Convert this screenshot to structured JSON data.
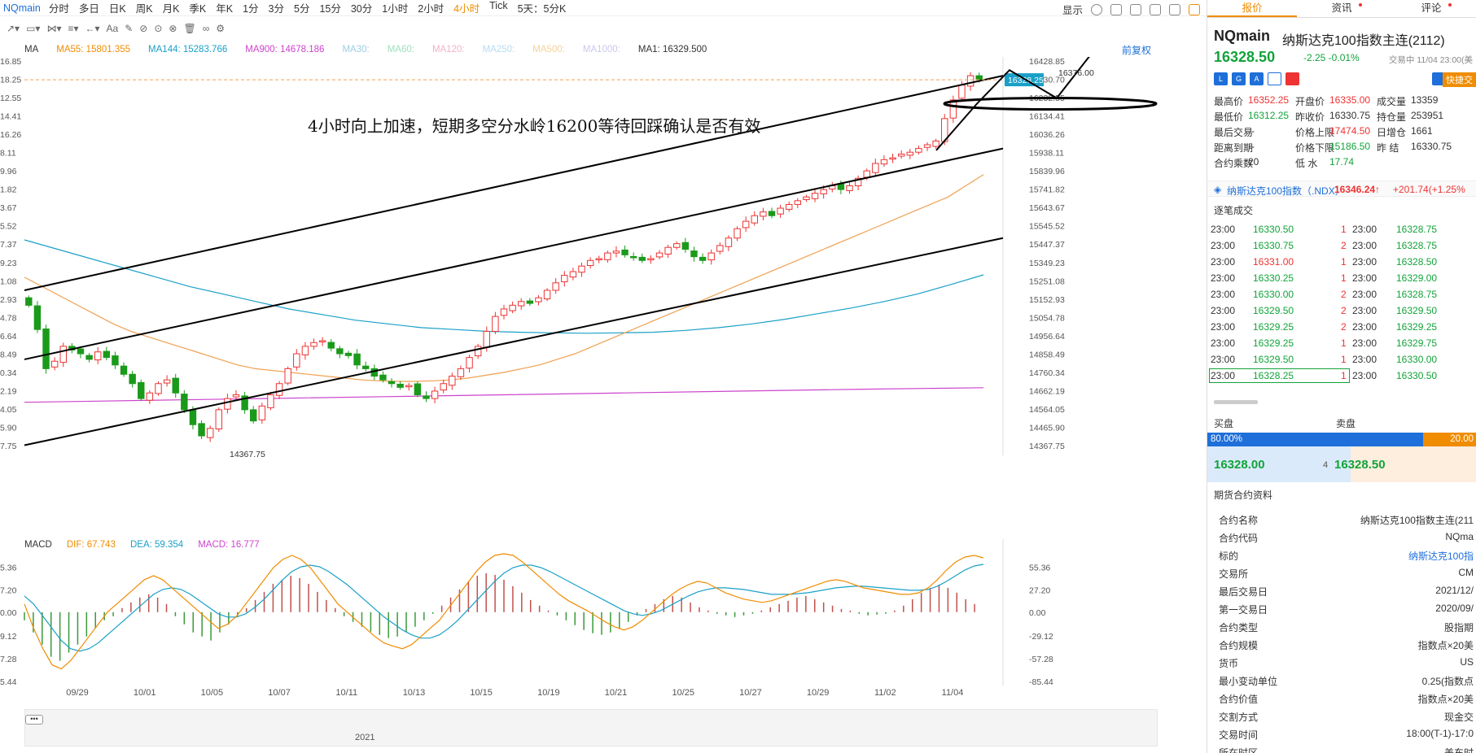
{
  "toolbar": {
    "symbol": "NQmain",
    "periods": [
      "分时",
      "多日",
      "日K",
      "周K",
      "月K",
      "季K",
      "年K",
      "1分",
      "3分",
      "5分",
      "15分",
      "30分",
      "1小时",
      "2小时",
      "4小时",
      "Tick",
      "5天：5分K"
    ],
    "active_period": "4小时",
    "display": "显示"
  },
  "indicators": {
    "ma_label": "MA",
    "items": [
      {
        "label": "MA55: 15801.355",
        "color": "#f08c00"
      },
      {
        "label": "MA144: 15283.766",
        "color": "#1aa0c8"
      },
      {
        "label": "MA900: 14678.186",
        "color": "#cc44cc"
      },
      {
        "label": "MA30:",
        "color": "#9ccde6"
      },
      {
        "label": "MA60:",
        "color": "#9fe0c0"
      },
      {
        "label": "MA120:",
        "color": "#f3b2c6"
      },
      {
        "label": "MA250:",
        "color": "#b7dbf2"
      },
      {
        "label": "MA500:",
        "color": "#f6d29a"
      },
      {
        "label": "MA1000:",
        "color": "#c9c9f0"
      },
      {
        "label": "MA1: 16329.500",
        "color": "#333333"
      }
    ],
    "fuquan": "前复权"
  },
  "chart_data": [
    {
      "type": "candlestick",
      "title": "",
      "y_ticks": [
        16428.85,
        16330.7,
        16232.55,
        16134.41,
        16036.26,
        15938.11,
        15839.96,
        15741.82,
        15643.67,
        15545.52,
        15447.37,
        15349.23,
        15251.08,
        15152.93,
        15054.78,
        14956.64,
        14858.49,
        14760.34,
        14662.19,
        14564.05,
        14465.9,
        14367.75
      ],
      "ylim": [
        14367.75,
        16428.85
      ],
      "x_labels": [
        "09/29",
        "10/01",
        "10/05",
        "10/07",
        "10/11",
        "10/13",
        "10/15",
        "10/19",
        "10/21",
        "10/25",
        "10/27",
        "10/29",
        "11/02",
        "11/04"
      ],
      "annotation": "4小时向上加速，短期多空分水岭16200等待回踩确认是否有效",
      "high_label": "16376.00",
      "low_label": "14367.75",
      "current_price_tag": "16328.25",
      "left_axis_labels": [
        "16.85",
        "18.25",
        "12.55",
        "14.41",
        "16.26",
        "8.11",
        "9.96",
        "1.82",
        "3.67",
        "5.52",
        "7.37",
        "9.23",
        "1.08",
        "2.93",
        "4.78",
        "6.64",
        "8.49",
        "0.34",
        "2.19",
        "4.05",
        "5.90",
        "7.75"
      ],
      "candles_close": [
        15120,
        14990,
        14780,
        14820,
        14900,
        14880,
        14860,
        14830,
        14870,
        14840,
        14800,
        14750,
        14700,
        14620,
        14650,
        14700,
        14720,
        14650,
        14560,
        14480,
        14420,
        14460,
        14560,
        14620,
        14640,
        14560,
        14500,
        14580,
        14640,
        14700,
        14780,
        14860,
        14900,
        14920,
        14930,
        14890,
        14860,
        14850,
        14800,
        14780,
        14740,
        14720,
        14700,
        14680,
        14690,
        14640,
        14620,
        14660,
        14700,
        14740,
        14780,
        14840,
        14900,
        14980,
        15060,
        15100,
        15120,
        15140,
        15130,
        15160,
        15200,
        15240,
        15280,
        15300,
        15330,
        15360,
        15370,
        15400,
        15410,
        15390,
        15380,
        15360,
        15370,
        15400,
        15430,
        15450,
        15420,
        15380,
        15360,
        15400,
        15440,
        15480,
        15530,
        15570,
        15600,
        15620,
        15600,
        15640,
        15660,
        15680,
        15700,
        15720,
        15740,
        15760,
        15740,
        15760,
        15800,
        15840,
        15880,
        15900,
        15910,
        15930,
        15940,
        15960,
        15980,
        16000,
        16120,
        16220,
        16300,
        16350,
        16330
      ],
      "ma55": [
        15270,
        15220,
        15170,
        15120,
        15070,
        15020,
        14980,
        14950,
        14920,
        14890,
        14860,
        14830,
        14800,
        14780,
        14770,
        14760,
        14750,
        14740,
        14730,
        14720,
        14715,
        14712,
        14712,
        14715,
        14720,
        14730,
        14745,
        14760,
        14780,
        14800,
        14830,
        14860,
        14900,
        14940,
        14980,
        15020,
        15060,
        15100,
        15140,
        15180,
        15220,
        15260,
        15300,
        15340,
        15380,
        15420,
        15460,
        15500,
        15540,
        15580,
        15620,
        15660,
        15700,
        15760,
        15820
      ],
      "ma144": [
        15470,
        15420,
        15370,
        15320,
        15270,
        15220,
        15180,
        15140,
        15100,
        15070,
        15040,
        15020,
        15000,
        14990,
        14980,
        14975,
        14972,
        14970,
        14972,
        14975,
        14985,
        15000,
        15020,
        15045,
        15075,
        15105,
        15140,
        15180,
        15230,
        15283
      ],
      "ma900": [
        14600,
        14610,
        14620,
        14630,
        14640,
        14650,
        14660,
        14670,
        14678
      ],
      "channel_lines": [
        {
          "from": [
            0,
            15200
          ],
          "to": [
            1,
            16350
          ]
        },
        {
          "from": [
            0,
            14830
          ],
          "to": [
            1,
            15960
          ]
        },
        {
          "from": [
            0,
            14370
          ],
          "to": [
            1,
            15480
          ]
        }
      ]
    },
    {
      "type": "macd",
      "dif": 67.743,
      "dea": 59.354,
      "macd": 16.777,
      "y_ticks": [
        55.36,
        27.2,
        0.0,
        -29.12,
        -57.28,
        -85.44
      ],
      "left_axis_labels": [
        "5.36",
        "7.20",
        "0.00",
        "9.12",
        "7.28",
        "5.44"
      ],
      "hist": [
        -10,
        -25,
        -40,
        -55,
        -60,
        -50,
        -40,
        -30,
        -20,
        -10,
        -5,
        5,
        12,
        18,
        22,
        18,
        10,
        -5,
        -15,
        -25,
        -30,
        -35,
        -25,
        -15,
        -5,
        5,
        15,
        25,
        35,
        40,
        45,
        42,
        35,
        25,
        15,
        5,
        -5,
        -12,
        -18,
        -24,
        -28,
        -32,
        -30,
        -25,
        -18,
        -10,
        -2,
        8,
        18,
        28,
        38,
        45,
        48,
        46,
        40,
        32,
        24,
        15,
        8,
        2,
        -4,
        -10,
        -16,
        -22,
        -26,
        -28,
        -25,
        -20,
        -12,
        -4,
        4,
        10,
        16,
        20,
        18,
        12,
        6,
        2,
        -2,
        -4,
        -6,
        -4,
        -2,
        2,
        6,
        10,
        14,
        18,
        20,
        16,
        12,
        8,
        4,
        2,
        -2,
        -4,
        -3,
        -2,
        2,
        8,
        16,
        24,
        30,
        34,
        30,
        24,
        16,
        10
      ],
      "dif_line": [
        10,
        -20,
        -45,
        -65,
        -70,
        -60,
        -45,
        -30,
        -15,
        0,
        10,
        20,
        30,
        40,
        45,
        40,
        30,
        20,
        10,
        0,
        -10,
        -20,
        -15,
        -5,
        10,
        25,
        40,
        55,
        65,
        70,
        65,
        55,
        40,
        25,
        10,
        0,
        -10,
        -20,
        -30,
        -38,
        -42,
        -45,
        -40,
        -30,
        -20,
        -10,
        5,
        20,
        35,
        50,
        62,
        70,
        72,
        70,
        62,
        52,
        42,
        32,
        22,
        14,
        8,
        2,
        -5,
        -12,
        -18,
        -22,
        -18,
        -10,
        0,
        10,
        20,
        28,
        34,
        38,
        36,
        30,
        24,
        20,
        16,
        14,
        12,
        14,
        18,
        22,
        26,
        30,
        34,
        38,
        40,
        38,
        34,
        30,
        28,
        26,
        24,
        22,
        22,
        24,
        30,
        40,
        52,
        62,
        68,
        70,
        67
      ],
      "dea_line": [
        20,
        10,
        -5,
        -20,
        -35,
        -45,
        -48,
        -45,
        -38,
        -28,
        -18,
        -8,
        2,
        12,
        22,
        28,
        30,
        28,
        22,
        14,
        6,
        -2,
        -6,
        -6,
        -2,
        6,
        16,
        28,
        40,
        50,
        56,
        58,
        56,
        50,
        42,
        34,
        24,
        14,
        4,
        -6,
        -14,
        -22,
        -28,
        -32,
        -32,
        -28,
        -20,
        -10,
        2,
        14,
        26,
        38,
        48,
        55,
        58,
        58,
        55,
        50,
        44,
        38,
        32,
        26,
        20,
        14,
        8,
        2,
        -2,
        -4,
        -2,
        2,
        8,
        14,
        20,
        25,
        28,
        30,
        30,
        29,
        28,
        26,
        24,
        22,
        22,
        22,
        23,
        24,
        26,
        28,
        30,
        31,
        32,
        32,
        31,
        30,
        29,
        28,
        27,
        27,
        28,
        32,
        38,
        45,
        52,
        57,
        59
      ]
    }
  ],
  "macd_row": {
    "label": "MACD",
    "dif": "DIF: 67.743",
    "dea": "DEA: 59.354",
    "macd": "MACD: 16.777"
  },
  "navigator": {
    "year": "2021",
    "dots": "•••"
  },
  "panel": {
    "tabs": [
      "报价",
      "资讯",
      "评论"
    ],
    "symbol": "NQmain",
    "name": "纳斯达克100指数主连(2112)",
    "price": "16328.50",
    "change": "-2.25  -0.01%",
    "time": "交易中 11/04 23:00(美",
    "quick_trade": "快捷交",
    "badges": [
      "L",
      "G",
      "A",
      "",
      "♥"
    ],
    "stats": [
      [
        {
          "k": "最高价",
          "v": "16352.25",
          "c": "red"
        },
        {
          "k": "开盘价",
          "v": "16335.00",
          "c": "red"
        },
        {
          "k": "成交量",
          "v": "13359",
          "c": ""
        }
      ],
      [
        {
          "k": "最低价",
          "v": "16312.25",
          "c": "green"
        },
        {
          "k": "昨收价",
          "v": "16330.75",
          "c": ""
        },
        {
          "k": "持仓量",
          "v": "253951",
          "c": ""
        }
      ],
      [
        {
          "k": "最后交易",
          "v": "--",
          "c": ""
        },
        {
          "k": "价格上限",
          "v": "17474.50",
          "c": "red"
        },
        {
          "k": "日增仓",
          "v": "1661",
          "c": ""
        }
      ],
      [
        {
          "k": "距离到期",
          "v": "--",
          "c": ""
        },
        {
          "k": "价格下限",
          "v": "15186.50",
          "c": "green"
        },
        {
          "k": "昨 结",
          "v": "16330.75",
          "c": ""
        }
      ],
      [
        {
          "k": "合约乘数",
          "v": "20",
          "c": ""
        },
        {
          "k": "低 水",
          "v": "17.74",
          "c": "green"
        },
        {
          "k": "",
          "v": "",
          "c": ""
        }
      ]
    ],
    "ndx": {
      "name": "纳斯达克100指数（.NDX）",
      "price": "16346.24↑",
      "change": "+201.74(+1.25%"
    },
    "ticks_title": "逐笔成交",
    "ticks": [
      {
        "t1": "23:00",
        "p1": "16330.50",
        "q1": "1",
        "c1": "green",
        "t2": "23:00",
        "p2": "16328.75"
      },
      {
        "t1": "23:00",
        "p1": "16330.75",
        "q1": "2",
        "c1": "green",
        "t2": "23:00",
        "p2": "16328.75"
      },
      {
        "t1": "23:00",
        "p1": "16331.00",
        "q1": "1",
        "c1": "red",
        "t2": "23:00",
        "p2": "16328.50"
      },
      {
        "t1": "23:00",
        "p1": "16330.25",
        "q1": "1",
        "c1": "green",
        "t2": "23:00",
        "p2": "16329.00"
      },
      {
        "t1": "23:00",
        "p1": "16330.00",
        "q1": "2",
        "c1": "green",
        "t2": "23:00",
        "p2": "16328.75"
      },
      {
        "t1": "23:00",
        "p1": "16329.50",
        "q1": "2",
        "c1": "green",
        "t2": "23:00",
        "p2": "16329.50"
      },
      {
        "t1": "23:00",
        "p1": "16329.25",
        "q1": "2",
        "c1": "green",
        "t2": "23:00",
        "p2": "16329.25"
      },
      {
        "t1": "23:00",
        "p1": "16329.25",
        "q1": "1",
        "c1": "green",
        "t2": "23:00",
        "p2": "16329.75"
      },
      {
        "t1": "23:00",
        "p1": "16329.50",
        "q1": "1",
        "c1": "green",
        "t2": "23:00",
        "p2": "16330.00"
      },
      {
        "t1": "23:00",
        "p1": "16328.25",
        "q1": "1",
        "c1": "green",
        "t2": "23:00",
        "p2": "16330.50"
      }
    ],
    "book": {
      "buy_label": "买盘",
      "sell_label": "卖盘",
      "buy_pct": "80.00%",
      "sell_pct": "20.00",
      "bid": "16328.00",
      "bid_qty": "4",
      "ask": "16328.50"
    },
    "cinfo_title": "期货合约资料",
    "cinfo": [
      {
        "k": "合约名称",
        "v": "纳斯达克100指数主连(211",
        "c": ""
      },
      {
        "k": "合约代码",
        "v": "NQma",
        "c": ""
      },
      {
        "k": "标的",
        "v": "纳斯达克100指",
        "c": "blue"
      },
      {
        "k": "交易所",
        "v": "CM",
        "c": ""
      },
      {
        "k": "最后交易日",
        "v": "2021/12/",
        "c": ""
      },
      {
        "k": "第一交易日",
        "v": "2020/09/",
        "c": ""
      },
      {
        "k": "合约类型",
        "v": "股指期",
        "c": ""
      },
      {
        "k": "合约规模",
        "v": "指数点×20美",
        "c": ""
      },
      {
        "k": "货币",
        "v": "US",
        "c": ""
      },
      {
        "k": "最小变动单位",
        "v": "0.25(指数点",
        "c": ""
      },
      {
        "k": "合约价值",
        "v": "指数点×20美",
        "c": ""
      },
      {
        "k": "交割方式",
        "v": "现金交",
        "c": ""
      },
      {
        "k": "交易时间",
        "v": "18:00(T-1)-17:0",
        "c": ""
      },
      {
        "k": "所在时区",
        "v": "美东时",
        "c": ""
      }
    ]
  }
}
